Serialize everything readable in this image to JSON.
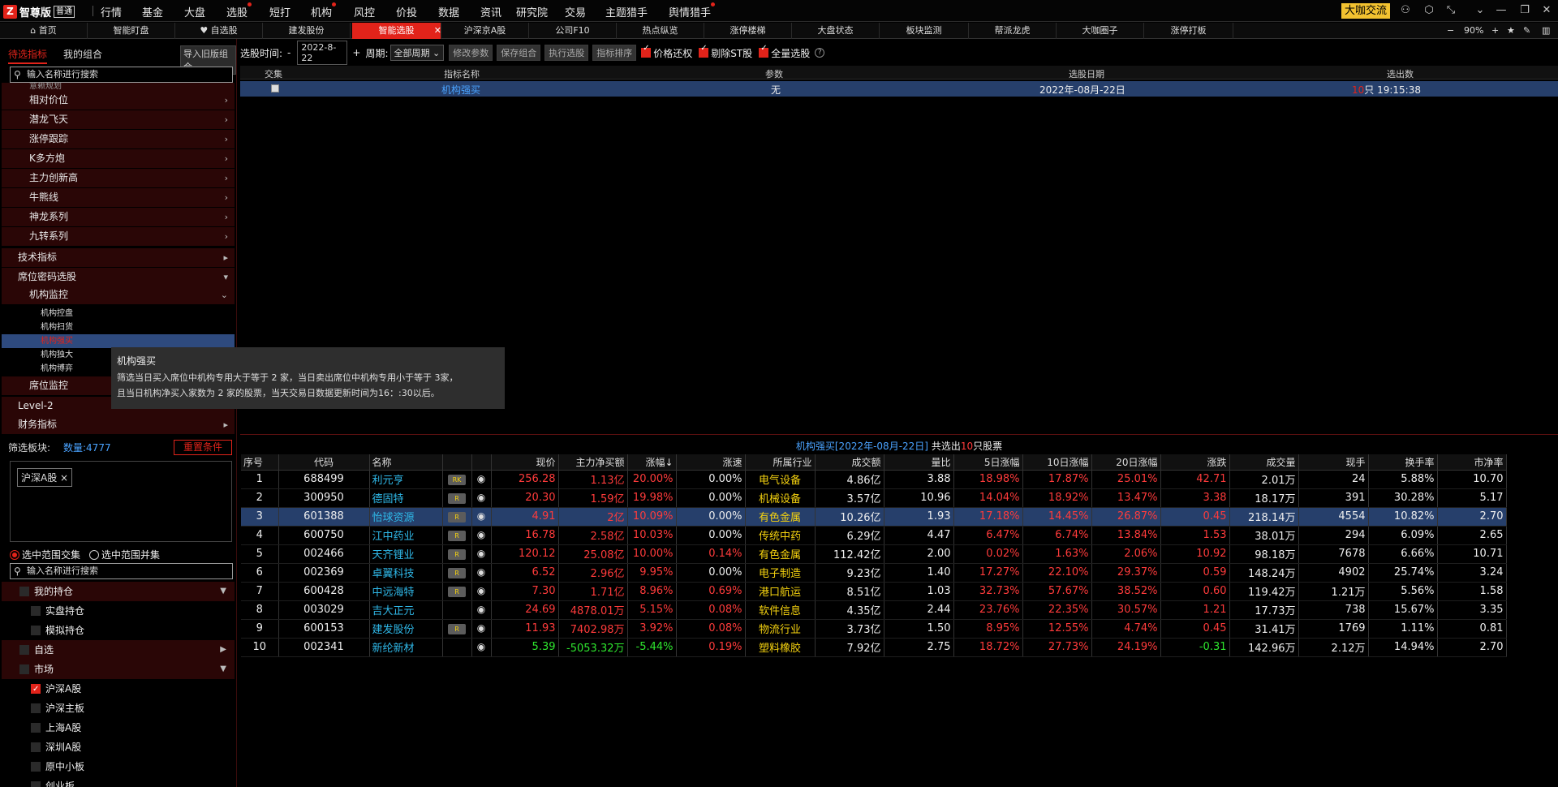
{
  "app": {
    "logo_mark": "Z",
    "name": "智尊版",
    "version_badge": "普通",
    "menu": [
      {
        "label": "行情",
        "dot": false
      },
      {
        "label": "基金",
        "dot": false
      },
      {
        "label": "大盘",
        "dot": false
      },
      {
        "label": "选股",
        "dot": true
      },
      {
        "label": "短打",
        "dot": false
      },
      {
        "label": "机构",
        "dot": true
      },
      {
        "label": "风控",
        "dot": false
      },
      {
        "label": "价投",
        "dot": false
      },
      {
        "label": "数据",
        "dot": false
      },
      {
        "label": "资讯",
        "dot": false
      },
      {
        "label": "研究院",
        "dot": false
      },
      {
        "label": "交易",
        "dot": false
      },
      {
        "label": "主题猎手",
        "dot": false
      },
      {
        "label": "舆情猎手",
        "dot": true
      }
    ],
    "daka_button": "大咖交流"
  },
  "tabs": [
    {
      "label": "⌂ 首页"
    },
    {
      "label": "智能盯盘"
    },
    {
      "label": "♥ 自选股"
    },
    {
      "label": "建发股份"
    },
    {
      "label": "智能选股",
      "active": true
    },
    {
      "label": "沪深京A股"
    },
    {
      "label": "公司F10"
    },
    {
      "label": "热点纵览"
    },
    {
      "label": "涨停楼梯"
    },
    {
      "label": "大盘状态"
    },
    {
      "label": "板块监测"
    },
    {
      "label": "帮派龙虎"
    },
    {
      "label": "大咖圈子"
    },
    {
      "label": "涨停打板"
    }
  ],
  "zoom": {
    "minus": "−",
    "value": "90%",
    "plus": "+"
  },
  "left": {
    "tab_pending": "待选指标",
    "tab_mine": "我的组合",
    "import_btn": "导入旧版组合",
    "search_placeholder": "输入名称进行搜索",
    "tree_partial": "意赖规划",
    "tree_sub": [
      "相对价位",
      "潜龙飞天",
      "涨停跟踪",
      "K多方炮",
      "主力创新高",
      "牛熊线",
      "神龙系列",
      "九转系列"
    ],
    "tree_tech": "技术指标",
    "tree_seat": "席位密码选股",
    "tree_inst": "机构监控",
    "tree_leaves": [
      "机构控盘",
      "机构扫货",
      "机构强买",
      "机构独大",
      "机构博弈"
    ],
    "tree_seat_monitor": "席位监控",
    "tree_level2": "Level-2",
    "tree_finance": "财务指标",
    "filter_label": "筛选板块:",
    "filter_count": "数量:4777",
    "reset_btn": "重置条件",
    "chip": "沪深A股",
    "chip_close": "×",
    "radio_intersect": "选中范围交集",
    "radio_union": "选中范围并集",
    "search2_placeholder": "输入名称进行搜索",
    "hold_header": "我的持仓",
    "hold_real": "实盘持仓",
    "hold_sim": "模拟持仓",
    "self_header": "自选",
    "market_header": "市场",
    "markets": [
      {
        "label": "沪深A股",
        "checked": true
      },
      {
        "label": "沪深主板",
        "checked": false
      },
      {
        "label": "上海A股",
        "checked": false
      },
      {
        "label": "深圳A股",
        "checked": false
      },
      {
        "label": "原中小板",
        "checked": false
      },
      {
        "label": "创业板",
        "checked": false
      }
    ]
  },
  "tooltip": {
    "title": "机构强买",
    "line1": "筛选当日买入席位中机构专用大于等于 2 家，当日卖出席位中机构专用小于等于 3家，",
    "line2": "且当日机构净买入家数为 2 家的股票，当天交易日数据更新时间为16：:30以后。"
  },
  "toolbar": {
    "time_label": "选股时间:",
    "minus": "-",
    "date": "2022-8-22",
    "plus": "+",
    "period_label": "周期:",
    "period_value": "全部周期",
    "btn_modify": "修改参数",
    "btn_save": "保存组合",
    "btn_exec": "执行选股",
    "btn_sort": "指标排序",
    "chk_price": "价格还权",
    "chk_st": "剔除ST股",
    "chk_all": "全量选股",
    "help": "?"
  },
  "upper": {
    "headers": {
      "intersect": "交集",
      "name": "指标名称",
      "params": "参数",
      "date": "选股日期",
      "count": "选出数"
    },
    "row": {
      "name": "机构强买",
      "params": "无",
      "date": "2022年-08月-22日",
      "count_num": "10",
      "count_rest": "只 19:15:38"
    }
  },
  "lower_title": {
    "prefix": "机构强买[2022年-08月-22日]",
    "mid": "共选出",
    "num": "10",
    "suffix": "只股票"
  },
  "grid": {
    "columns": [
      "序号",
      "代码",
      "名称",
      "",
      "",
      "现价",
      "主力净买额",
      "涨幅↓",
      "涨速",
      "所属行业",
      "成交额",
      "量比",
      "5日涨幅",
      "10日涨幅",
      "20日涨幅",
      "涨跌",
      "成交量",
      "现手",
      "换手率",
      "市净率"
    ],
    "rows": [
      {
        "n": "1",
        "code": "688499",
        "name": "利元亨",
        "badge": "RK",
        "price": "256.28",
        "net": "1.13亿",
        "chg": "20.00%",
        "speed": "0.00%",
        "ind": "电气设备",
        "amt": "4.86亿",
        "vr": "3.88",
        "d5": "18.98%",
        "d10": "17.87%",
        "d20": "25.01%",
        "diff": "42.71",
        "vol": "2.01万",
        "hand": "24",
        "turn": "5.88%",
        "pb": "10.70",
        "dir": "up"
      },
      {
        "n": "2",
        "code": "300950",
        "name": "德固特",
        "badge": "R",
        "price": "20.30",
        "net": "1.59亿",
        "chg": "19.98%",
        "speed": "0.00%",
        "ind": "机械设备",
        "amt": "3.57亿",
        "vr": "10.96",
        "d5": "14.04%",
        "d10": "18.92%",
        "d20": "13.47%",
        "diff": "3.38",
        "vol": "18.17万",
        "hand": "391",
        "turn": "30.28%",
        "pb": "5.17",
        "dir": "up"
      },
      {
        "n": "3",
        "code": "601388",
        "name": "怡球资源",
        "badge": "R",
        "price": "4.91",
        "net": "2亿",
        "chg": "10.09%",
        "speed": "0.00%",
        "ind": "有色金属",
        "amt": "10.26亿",
        "vr": "1.93",
        "d5": "17.18%",
        "d10": "14.45%",
        "d20": "26.87%",
        "diff": "0.45",
        "vol": "218.14万",
        "hand": "4554",
        "turn": "10.82%",
        "pb": "2.70",
        "dir": "up",
        "selected": true
      },
      {
        "n": "4",
        "code": "600750",
        "name": "江中药业",
        "badge": "R",
        "price": "16.78",
        "net": "2.58亿",
        "chg": "10.03%",
        "speed": "0.00%",
        "ind": "传统中药",
        "amt": "6.29亿",
        "vr": "4.47",
        "d5": "6.47%",
        "d10": "6.74%",
        "d20": "13.84%",
        "diff": "1.53",
        "vol": "38.01万",
        "hand": "294",
        "turn": "6.09%",
        "pb": "2.65",
        "dir": "up"
      },
      {
        "n": "5",
        "code": "002466",
        "name": "天齐锂业",
        "badge": "R",
        "price": "120.12",
        "net": "25.08亿",
        "chg": "10.00%",
        "speed": "0.14%",
        "ind": "有色金属",
        "amt": "112.42亿",
        "vr": "2.00",
        "d5": "0.02%",
        "d10": "1.63%",
        "d20": "2.06%",
        "diff": "10.92",
        "vol": "98.18万",
        "hand": "7678",
        "turn": "6.66%",
        "pb": "10.71",
        "dir": "up"
      },
      {
        "n": "6",
        "code": "002369",
        "name": "卓翼科技",
        "badge": "R",
        "price": "6.52",
        "net": "2.96亿",
        "chg": "9.95%",
        "speed": "0.00%",
        "ind": "电子制造",
        "amt": "9.23亿",
        "vr": "1.40",
        "d5": "17.27%",
        "d10": "22.10%",
        "d20": "29.37%",
        "diff": "0.59",
        "vol": "148.24万",
        "hand": "4902",
        "turn": "25.74%",
        "pb": "3.24",
        "dir": "up"
      },
      {
        "n": "7",
        "code": "600428",
        "name": "中远海特",
        "badge": "R",
        "price": "7.30",
        "net": "1.71亿",
        "chg": "8.96%",
        "speed": "0.69%",
        "ind": "港口航运",
        "amt": "8.51亿",
        "vr": "1.03",
        "d5": "32.73%",
        "d10": "57.67%",
        "d20": "38.52%",
        "diff": "0.60",
        "vol": "119.42万",
        "hand": "1.21万",
        "turn": "5.56%",
        "pb": "1.58",
        "dir": "up"
      },
      {
        "n": "8",
        "code": "003029",
        "name": "吉大正元",
        "badge": "",
        "price": "24.69",
        "net": "4878.01万",
        "chg": "5.15%",
        "speed": "0.08%",
        "ind": "软件信息",
        "amt": "4.35亿",
        "vr": "2.44",
        "d5": "23.76%",
        "d10": "22.35%",
        "d20": "30.57%",
        "diff": "1.21",
        "vol": "17.73万",
        "hand": "738",
        "turn": "15.67%",
        "pb": "3.35",
        "dir": "up"
      },
      {
        "n": "9",
        "code": "600153",
        "name": "建发股份",
        "badge": "R",
        "price": "11.93",
        "net": "7402.98万",
        "chg": "3.92%",
        "speed": "0.08%",
        "ind": "物流行业",
        "amt": "3.73亿",
        "vr": "1.50",
        "d5": "8.95%",
        "d10": "12.55%",
        "d20": "4.74%",
        "diff": "0.45",
        "vol": "31.41万",
        "hand": "1769",
        "turn": "1.11%",
        "pb": "0.81",
        "dir": "up"
      },
      {
        "n": "10",
        "code": "002341",
        "name": "新纶新材",
        "badge": "",
        "price": "5.39",
        "net": "-5053.32万",
        "chg": "-5.44%",
        "speed": "0.19%",
        "ind": "塑料橡胶",
        "amt": "7.92亿",
        "vr": "2.75",
        "d5": "18.72%",
        "d10": "27.73%",
        "d20": "24.19%",
        "diff": "-0.31",
        "vol": "142.96万",
        "hand": "2.12万",
        "turn": "14.94%",
        "pb": "2.70",
        "dir": "down"
      }
    ]
  },
  "colors": {
    "accent_red": "#e2231a",
    "up": "#ff3b3b",
    "down": "#2ee62e",
    "code_blue": "#2fb8e8",
    "industry_yellow": "#f5d20f",
    "selection": "#263f6b"
  }
}
